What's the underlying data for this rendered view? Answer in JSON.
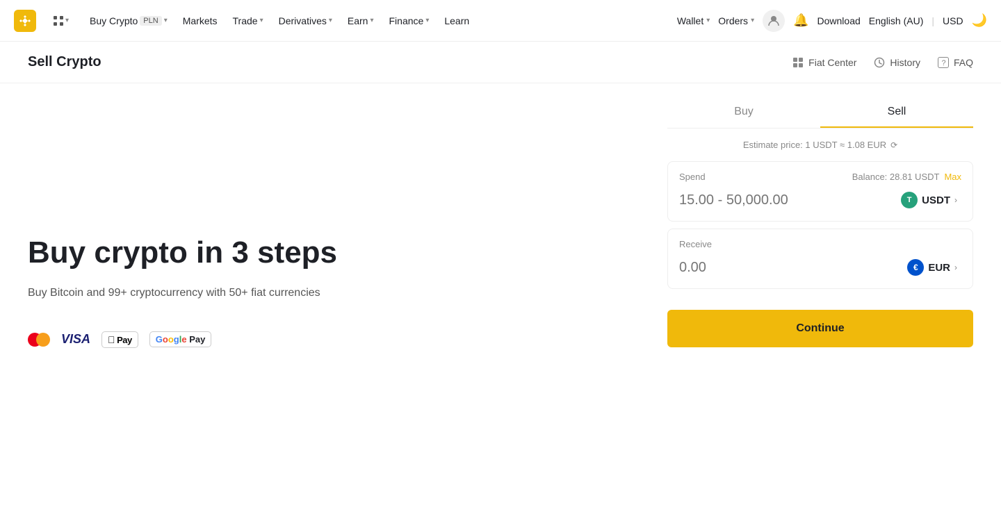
{
  "navbar": {
    "logo_alt": "Binance",
    "nav_items": [
      {
        "label": "Buy Crypto",
        "badge": "PLN",
        "has_chevron": true
      },
      {
        "label": "Markets",
        "has_chevron": false
      },
      {
        "label": "Trade",
        "has_chevron": true
      },
      {
        "label": "Derivatives",
        "has_chevron": true
      },
      {
        "label": "Earn",
        "has_chevron": true
      },
      {
        "label": "Finance",
        "has_chevron": true
      },
      {
        "label": "Learn",
        "has_chevron": false
      }
    ],
    "wallet_label": "Wallet",
    "orders_label": "Orders",
    "download_label": "Download",
    "locale_label": "English (AU)",
    "currency_label": "USD"
  },
  "subheader": {
    "title": "Sell Crypto",
    "actions": [
      {
        "label": "Fiat Center",
        "icon": "grid-icon"
      },
      {
        "label": "History",
        "icon": "clock-icon"
      },
      {
        "label": "FAQ",
        "icon": "question-icon"
      }
    ]
  },
  "hero": {
    "title": "Buy crypto in 3 steps",
    "subtitle": "Buy Bitcoin and 99+ cryptocurrency with 50+ fiat currencies"
  },
  "tabs": {
    "buy_label": "Buy",
    "sell_label": "Sell",
    "active": "sell"
  },
  "trade_panel": {
    "estimate": "Estimate price: 1 USDT ≈ 1.08 EUR",
    "spend_label": "Spend",
    "balance_label": "Balance: 28.81 USDT",
    "max_label": "Max",
    "spend_placeholder": "15.00 - 50,000.00",
    "spend_currency": "USDT",
    "receive_label": "Receive",
    "receive_value": "0.00",
    "receive_currency": "EUR",
    "continue_label": "Continue"
  },
  "payment_methods": [
    "Mastercard",
    "Visa",
    "Apple Pay",
    "Google Pay"
  ]
}
